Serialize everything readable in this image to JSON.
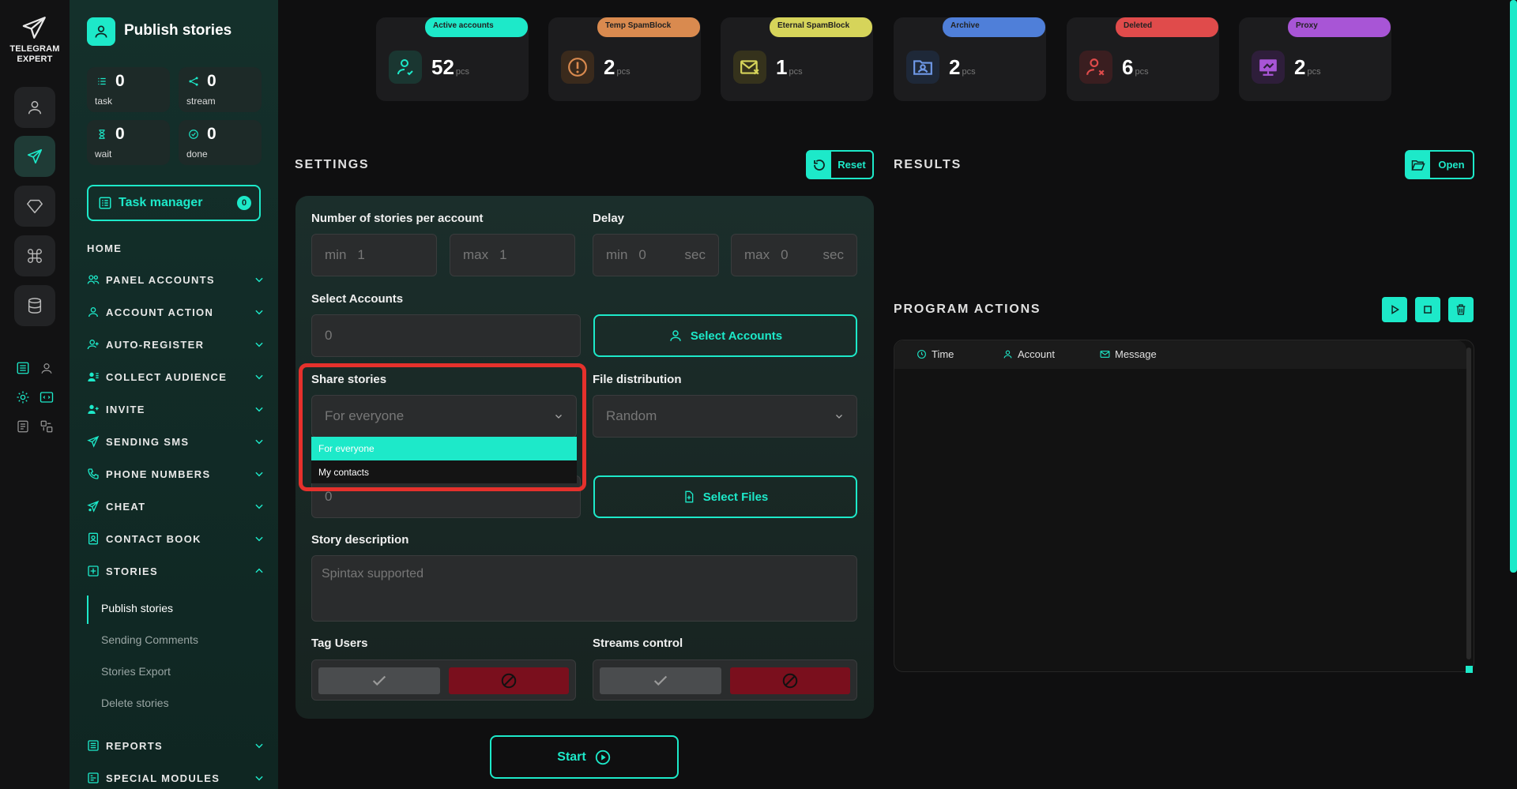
{
  "brand": {
    "line1": "TELEGRAM",
    "line2": "EXPERT"
  },
  "colors": {
    "accent": "#1de9c9",
    "danger": "#e5312c",
    "tag_no": "#7a0f1d"
  },
  "header": {
    "title": "Publish stories"
  },
  "stats": [
    {
      "label": "task",
      "value": "0",
      "icon": "task-list-icon"
    },
    {
      "label": "stream",
      "value": "0",
      "icon": "share-icon"
    },
    {
      "label": "wait",
      "value": "0",
      "icon": "hourglass-icon"
    },
    {
      "label": "done",
      "value": "0",
      "icon": "check-circle-icon"
    }
  ],
  "task_manager": {
    "label": "Task manager",
    "count": "0"
  },
  "nav": {
    "home": "HOME",
    "items": [
      {
        "label": "PANEL ACCOUNTS"
      },
      {
        "label": "ACCOUNT ACTION"
      },
      {
        "label": "AUTO-REGISTER"
      },
      {
        "label": "COLLECT AUDIENCE"
      },
      {
        "label": "INVITE"
      },
      {
        "label": "SENDING SMS"
      },
      {
        "label": "PHONE NUMBERS"
      },
      {
        "label": "CHEAT"
      },
      {
        "label": "CONTACT BOOK"
      },
      {
        "label": "STORIES"
      },
      {
        "label": "REPORTS"
      },
      {
        "label": "SPECIAL MODULES"
      }
    ],
    "stories_sub": [
      "Publish stories",
      "Sending Comments",
      "Stories Export",
      "Delete stories"
    ]
  },
  "cards": [
    {
      "badge": "Active accounts",
      "value": "52",
      "unit": "pcs",
      "color": "#1de9c9",
      "icon": "user-check-icon"
    },
    {
      "badge": "Temp SpamBlock",
      "value": "2",
      "unit": "pcs",
      "color": "#d98a4f",
      "icon": "warning-icon"
    },
    {
      "badge": "Eternal SpamBlock",
      "value": "1",
      "unit": "pcs",
      "color": "#d6d45a",
      "icon": "mail-block-icon"
    },
    {
      "badge": "Archive",
      "value": "2",
      "unit": "pcs",
      "color": "#4f7fd9",
      "icon": "archive-folder-icon"
    },
    {
      "badge": "Deleted",
      "value": "6",
      "unit": "pcs",
      "color": "#e04b4b",
      "icon": "user-x-icon"
    },
    {
      "badge": "Proxy",
      "value": "2",
      "unit": "pcs",
      "color": "#a855d6",
      "icon": "proxy-icon"
    }
  ],
  "settings": {
    "title": "SETTINGS",
    "reset": "Reset",
    "stories_per_account": {
      "label": "Number of stories per account",
      "min_label": "min",
      "min_value": "1",
      "max_label": "max",
      "max_value": "1"
    },
    "delay": {
      "label": "Delay",
      "min_label": "min",
      "min_value": "0",
      "max_label": "max",
      "max_value": "0",
      "unit": "sec"
    },
    "select_accounts": {
      "label": "Select Accounts",
      "value": "0",
      "button": "Select Accounts"
    },
    "share_stories": {
      "label": "Share stories",
      "selected": "For everyone",
      "options": [
        "For everyone",
        "My contacts"
      ]
    },
    "file_distribution": {
      "label": "File distribution",
      "selected": "Random"
    },
    "files": {
      "value": "0",
      "button": "Select Files"
    },
    "story_description": {
      "label": "Story description",
      "placeholder": "Spintax supported"
    },
    "tag_users": {
      "label": "Tag Users"
    },
    "streams_control": {
      "label": "Streams control"
    },
    "start": "Start"
  },
  "results": {
    "title": "RESULTS",
    "open": "Open"
  },
  "program_actions": {
    "title": "PROGRAM ACTIONS",
    "columns": [
      "Time",
      "Account",
      "Message"
    ]
  }
}
